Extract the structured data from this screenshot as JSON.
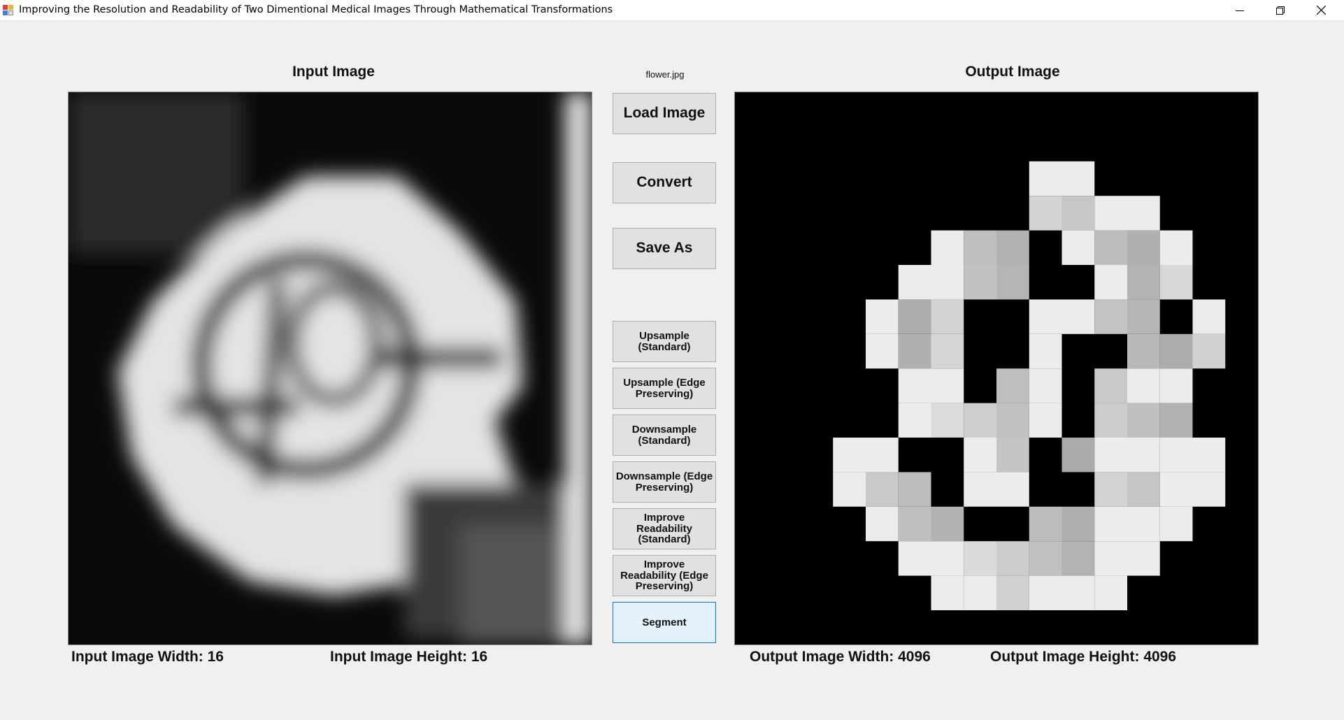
{
  "window": {
    "title": "Improving the Resolution and Readability of Two Dimentional Medical Images Through Mathematical Transformations"
  },
  "labels": {
    "input_title": "Input Image",
    "output_title": "Output Image",
    "filename": "flower.jpg"
  },
  "buttons": {
    "load": "Load Image",
    "convert": "Convert",
    "save": "Save As",
    "upsample_standard": "Upsample (Standard)",
    "upsample_edge": "Upsample (Edge Preserving)",
    "downsample_standard": "Downsample (Standard)",
    "downsample_edge": "Downsample (Edge Preserving)",
    "improve_standard": "Improve Readability (Standard)",
    "improve_edge": "Improve Readability (Edge Preserving)",
    "segment": "Segment"
  },
  "dimensions": {
    "input_width": "Input Image Width: 16",
    "input_height": "Input Image Height: 16",
    "output_width": "Output Image Width: 4096",
    "output_height": "Output Image Height: 4096"
  },
  "icons": {
    "app": "app-icon",
    "minimize": "minimize-icon",
    "restore": "restore-icon",
    "close": "close-icon"
  },
  "colors": {
    "window_bg": "#f0f0f0",
    "button_bg": "#e1e1e1",
    "focus_border": "#0078d7",
    "focus_bg": "#e5f1fb"
  }
}
